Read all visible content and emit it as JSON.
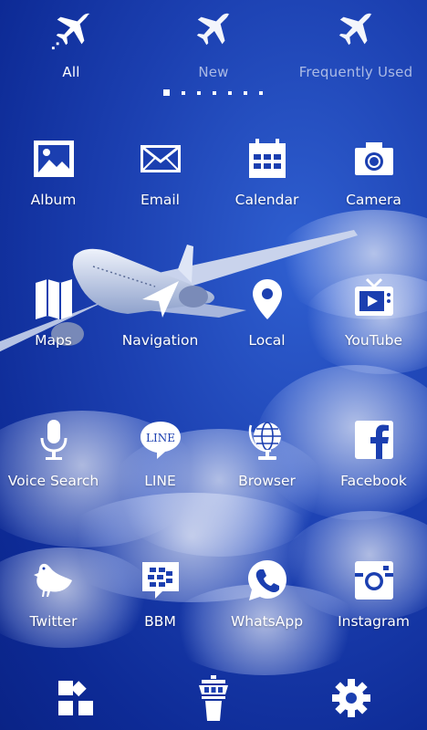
{
  "tabs": [
    {
      "label": "All",
      "icon": "airplane-takeoff-icon",
      "active": true
    },
    {
      "label": "New",
      "icon": "airplane-icon",
      "active": false
    },
    {
      "label": "Frequently Used",
      "icon": "airplane-icon",
      "active": false
    }
  ],
  "pager": {
    "pages": 7,
    "current": 1
  },
  "apps": [
    {
      "label": "Album",
      "icon": "image-icon"
    },
    {
      "label": "Email",
      "icon": "envelope-icon"
    },
    {
      "label": "Calendar",
      "icon": "calendar-icon"
    },
    {
      "label": "Camera",
      "icon": "camera-icon"
    },
    {
      "label": "Maps",
      "icon": "folded-map-icon"
    },
    {
      "label": "Navigation",
      "icon": "navigation-arrow-icon"
    },
    {
      "label": "Local",
      "icon": "location-pin-icon"
    },
    {
      "label": "YouTube",
      "icon": "tv-play-icon"
    },
    {
      "label": "Voice Search",
      "icon": "microphone-icon"
    },
    {
      "label": "LINE",
      "icon": "line-bubble-icon",
      "icon_text": "LINE"
    },
    {
      "label": "Browser",
      "icon": "globe-icon"
    },
    {
      "label": "Facebook",
      "icon": "facebook-icon"
    },
    {
      "label": "Twitter",
      "icon": "bird-icon"
    },
    {
      "label": "BBM",
      "icon": "bbm-icon"
    },
    {
      "label": "WhatsApp",
      "icon": "whatsapp-phone-icon"
    },
    {
      "label": "Instagram",
      "icon": "instagram-icon"
    }
  ],
  "dock": [
    {
      "icon": "widgets-icon"
    },
    {
      "icon": "control-tower-icon"
    },
    {
      "icon": "settings-gear-icon"
    }
  ],
  "colors": {
    "background": "#1b3fb0",
    "foreground": "#ffffff",
    "accent_dark": "#0d2a95"
  }
}
